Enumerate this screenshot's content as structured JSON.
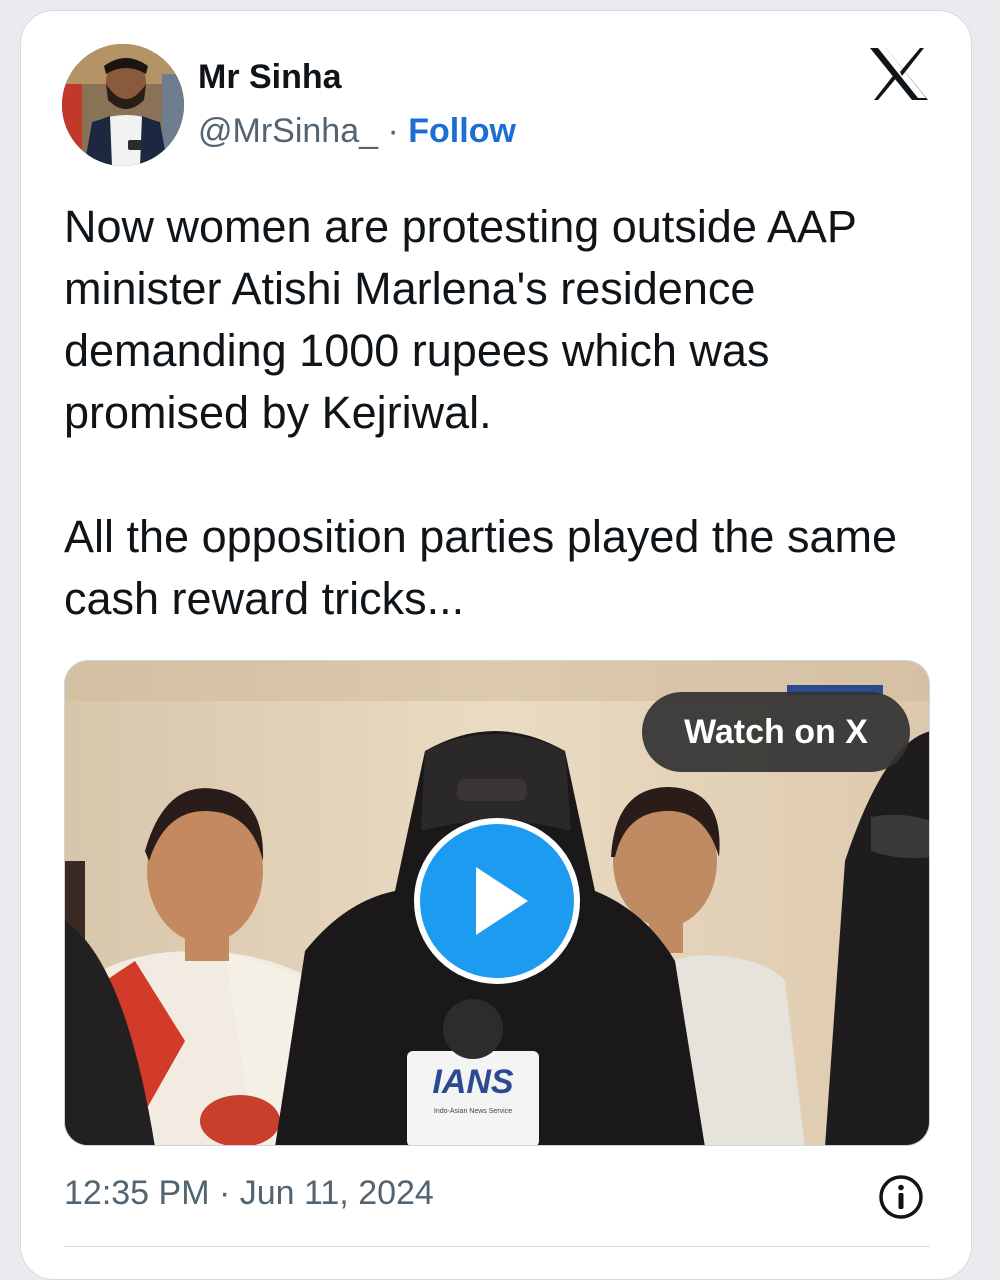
{
  "author": {
    "name": "Mr Sinha",
    "handle": "@MrSinha_",
    "separator": "·",
    "follow_label": "Follow"
  },
  "platform_icon": "x-logo-icon",
  "tweet": {
    "paragraphs": [
      "Now women are protesting outside AAP minister Atishi Marlena's residence demanding 1000 rupees which was promised by Kejriwal.",
      "All the opposition parties played the same cash reward tricks..."
    ]
  },
  "media": {
    "type": "video",
    "watch_label": "Watch on X",
    "play_icon": "play-icon",
    "mic_brand": "IANS",
    "mic_subtitle": "Indo-Asian News Service"
  },
  "footer": {
    "timestamp": "12:35 PM · Jun 11, 2024",
    "info_icon": "info-icon"
  },
  "colors": {
    "follow": "#1d6ed3",
    "play_button": "#1d9bf0",
    "secondary_text": "#536471"
  }
}
